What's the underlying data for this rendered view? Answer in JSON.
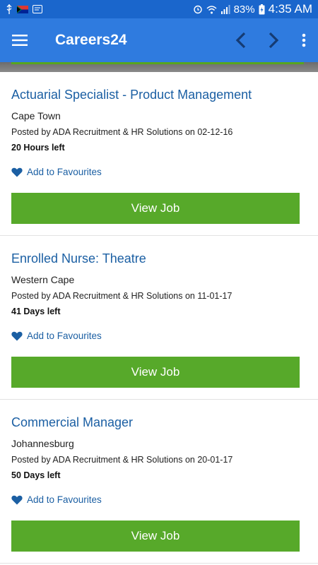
{
  "status_bar": {
    "battery": "83%",
    "time": "4:35 AM"
  },
  "app_bar": {
    "title": "Careers24",
    "icons": [
      "menu-icon",
      "chevron-left-icon",
      "chevron-right-icon",
      "overflow-menu-icon"
    ]
  },
  "jobs": [
    {
      "title": "Actuarial Specialist - Product Management",
      "location": "Cape Town",
      "posted": "Posted by ADA Recruitment & HR Solutions on 02-12-16",
      "time_left": "20 Hours left",
      "favourite_label": "Add to Favourites",
      "button_label": "View Job"
    },
    {
      "title": "Enrolled Nurse: Theatre",
      "location": "Western Cape",
      "posted": "Posted by ADA Recruitment & HR Solutions on 11-01-17",
      "time_left": "41 Days left",
      "favourite_label": "Add to Favourites",
      "button_label": "View Job"
    },
    {
      "title": "Commercial Manager",
      "location": "Johannesburg",
      "posted": "Posted by ADA Recruitment & HR Solutions on 20-01-17",
      "time_left": "50 Days left",
      "favourite_label": "Add to Favourites",
      "button_label": "View Job"
    }
  ],
  "colors": {
    "status_bar": "#1a66cc",
    "app_bar": "#2f7bdf",
    "link": "#1b5fa3",
    "button": "#57a92a"
  }
}
